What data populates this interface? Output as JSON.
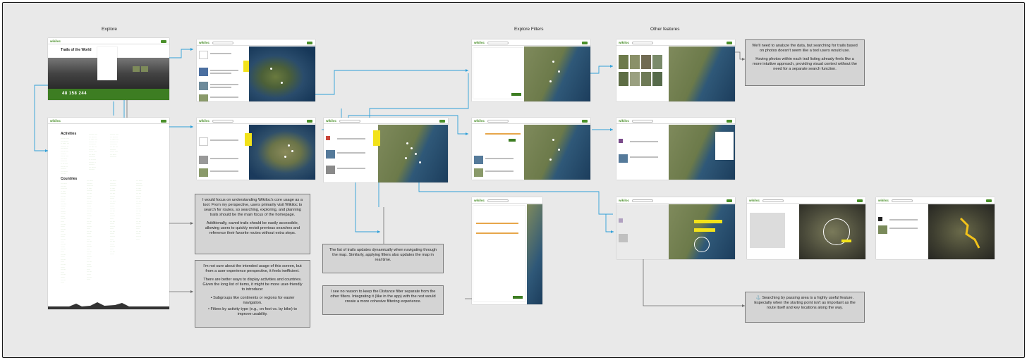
{
  "sections": {
    "explore": "Explore",
    "explore_filters": "Explore Filters",
    "other_features": "Other features"
  },
  "screens": {
    "logo": "wikiloc",
    "home_title": "Trails of the World",
    "home_counter": "48 158 244",
    "activities_heading": "Activities",
    "countries_heading": "Countries"
  },
  "notes": {
    "homepage": {
      "p1": "I would focus on understanding Wikiloc's core usage as a tool. From my perspective, users primarily visit Wikiloc to search for routes, so searching, exploring, and planning trails should be the main focus of the homepage.",
      "p2": "Additionally, saved trails should be easily accessible, allowing users to quickly revisit previous searches and reference their favorite routes without extra steps."
    },
    "lists": {
      "p1": "I'm not sure about the intended usage of this screen, but from a user experience perspective, it feels inefficient.",
      "p2": "There are better ways to display activities and countries. Given the long list of items, it might be more user-friendly to introduce:",
      "b1": "•  Subgroups like continents or regions for easier navigation.",
      "b2": "•  Filters by activity type (e.g., on foot vs. by bike) to improve usability."
    },
    "map_list": {
      "p1": "The list of trails updates dynamically when navigating through the map. Similarly, applying filters also updates the map in real time."
    },
    "distance": {
      "p1": "I see no reason to keep the Distance filter separate from the other filters. Integrating it (like in the app) with the rest would create a more cohesive filtering experience."
    },
    "photos": {
      "p1": "We'll need to analyze the data, but searching for trails based on photos doesn't seem like a tool users would use.",
      "p2": "Having photos within each trail listing already feels like a more intuitive approach, providing visual context without the need for a separate search function."
    },
    "passing": {
      "p1": "⚓ Searching by passing area is a highly useful feature. Especially when the starting point isn't as important as the route itself and key locations along the way."
    }
  },
  "colors": {
    "board": "#e9e9e9",
    "connector": "#2e9fd8",
    "connector_gray": "#6d6d6d",
    "brand_green": "#4a8f2a",
    "note_bg": "#d4d4d4"
  }
}
